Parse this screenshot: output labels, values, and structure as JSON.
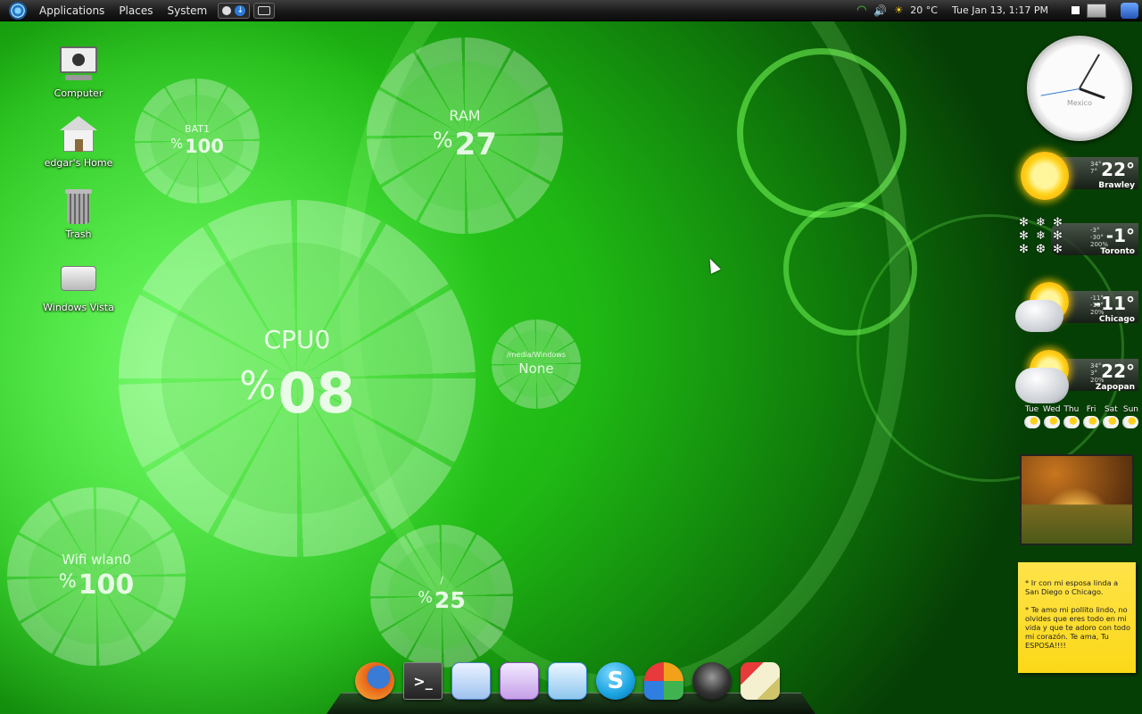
{
  "panel": {
    "menus": [
      "Applications",
      "Places",
      "System"
    ],
    "weather_temp": "20 °C",
    "datetime": "Tue Jan 13,  1:17 PM"
  },
  "desktop_icons": [
    {
      "label": "Computer"
    },
    {
      "label": "edgar's Home"
    },
    {
      "label": "Trash"
    },
    {
      "label": "Windows Vista"
    }
  ],
  "monitors": {
    "bat": {
      "label": "BAT1",
      "pct": "%",
      "value": "100"
    },
    "ram": {
      "label": "RAM",
      "pct": "%",
      "value": "27"
    },
    "cpu": {
      "label": "CPU0",
      "pct": "%",
      "value": "08"
    },
    "media": {
      "label": "/media/Windows",
      "value": "None"
    },
    "wifi": {
      "label": "Wifi wlan0",
      "pct": "%",
      "value": "100"
    },
    "root": {
      "label": "/",
      "pct": "%",
      "value": "25"
    }
  },
  "clock": {
    "city": "Mexico"
  },
  "weather": [
    {
      "temp": "22°",
      "hi": "34°",
      "lo": "7°",
      "extra": "",
      "city": "Brawley",
      "icon": "sun-icon"
    },
    {
      "temp": "-1°",
      "hi": "-3°",
      "lo": "-30°",
      "extra": "200%",
      "city": "Toronto",
      "icon": "snow-icon"
    },
    {
      "temp": "-11°",
      "hi": "-11°",
      "lo": "-18°",
      "extra": "20%",
      "city": "Chicago",
      "icon": "partly-cloudy-icon"
    },
    {
      "temp": "22°",
      "hi": "34°",
      "lo": "3°",
      "extra": "20%",
      "city": "Zapopan",
      "icon": "partly-cloudy-icon"
    }
  ],
  "forecast": [
    "Tue",
    "Wed",
    "Thu",
    "Fri",
    "Sat",
    "Sun"
  ],
  "sticky_note": {
    "line1": "* Ir con mi esposa linda a San Diego o Chicago.",
    "line2": "* Te amo mi pollito lindo, no olvides que eres todo en mi vida y que te adoro con todo mi corazón. Te ama, Tu ESPOSA!!!!"
  },
  "dock": [
    {
      "name": "firefox",
      "icon": "firefox-icon",
      "color": "#e8621b"
    },
    {
      "name": "terminal",
      "icon": "terminal-icon",
      "color": "#2b2b2b",
      "glyph": ">_"
    },
    {
      "name": "writer",
      "icon": "writer-icon",
      "color": "#2f74c9"
    },
    {
      "name": "impress",
      "icon": "impress-icon",
      "color": "#a14fc2"
    },
    {
      "name": "draw",
      "icon": "draw-icon",
      "color": "#2e8fd6"
    },
    {
      "name": "skype",
      "icon": "skype-icon",
      "color": "#1aa3e0",
      "glyph": "S"
    },
    {
      "name": "messenger",
      "icon": "messenger-icon",
      "color": "#f1a21a"
    },
    {
      "name": "gimp",
      "icon": "gimp-icon",
      "color": "#333333"
    },
    {
      "name": "paint",
      "icon": "paint-icon",
      "color": "#d0c46b"
    }
  ]
}
